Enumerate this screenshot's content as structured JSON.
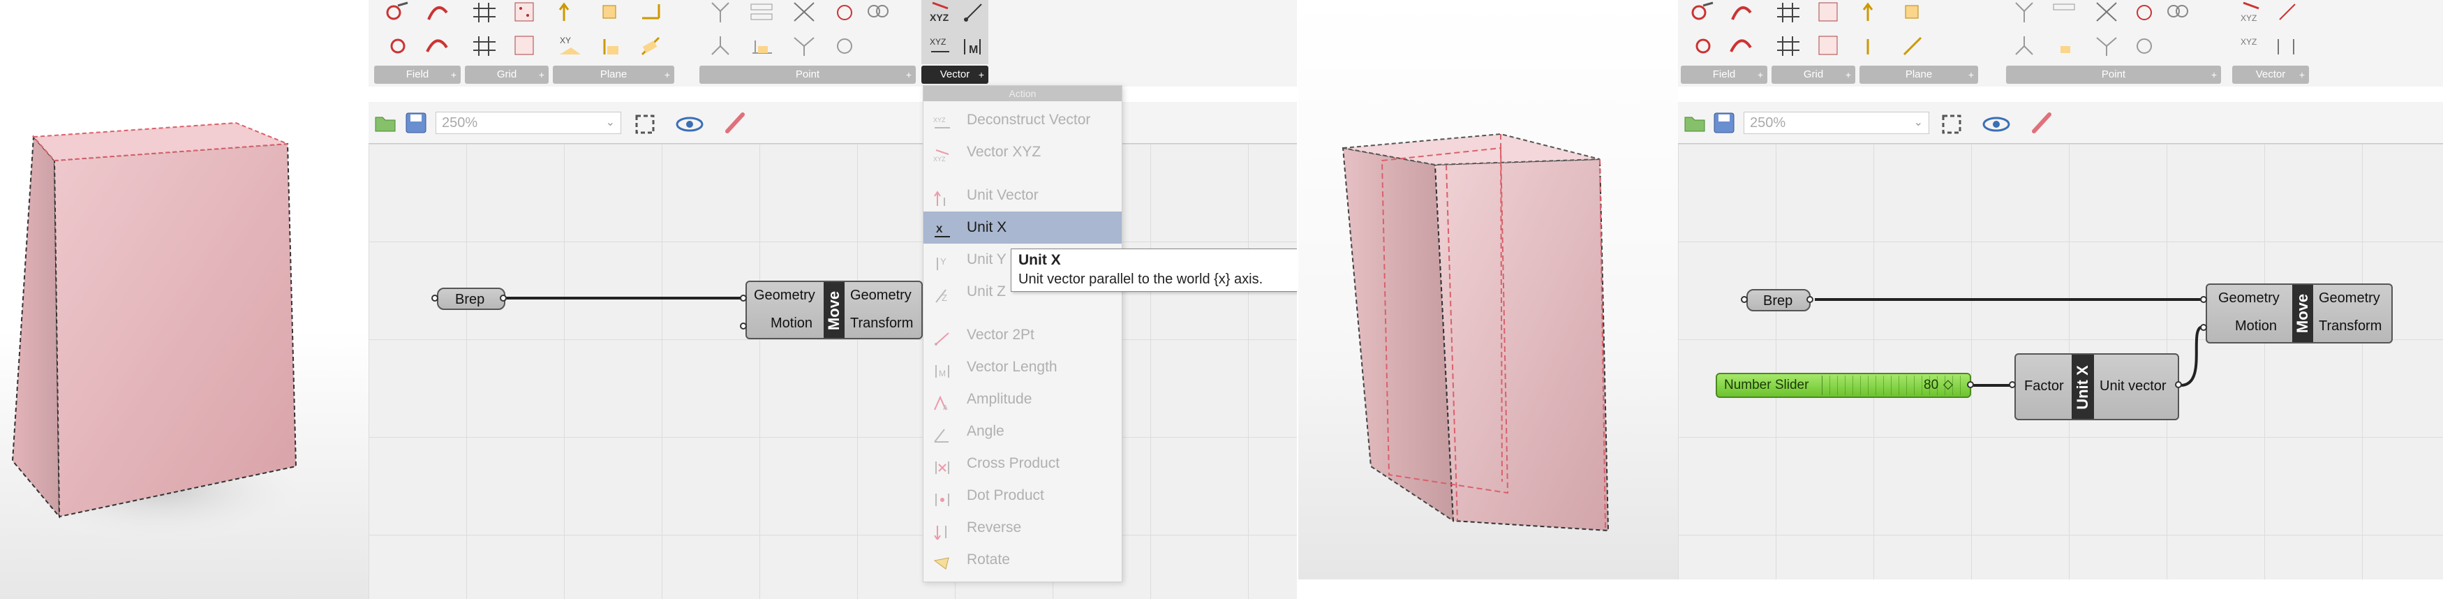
{
  "left_toolbar": {
    "groups": [
      "Field",
      "Grid",
      "Plane",
      "Point",
      "Vector"
    ],
    "zoom": "250%"
  },
  "right_toolbar": {
    "groups": [
      "Field",
      "Grid",
      "Plane",
      "Point",
      "Vector"
    ],
    "zoom": "250%"
  },
  "dropdown": {
    "header": "Action",
    "items": [
      {
        "label": "Deconstruct Vector"
      },
      {
        "label": "Vector XYZ"
      },
      {
        "label": "Unit Vector"
      },
      {
        "label": "Unit X"
      },
      {
        "label": "Unit Y"
      },
      {
        "label": "Unit Z"
      },
      {
        "label": "Vector 2Pt"
      },
      {
        "label": "Vector Length"
      },
      {
        "label": "Amplitude"
      },
      {
        "label": "Angle"
      },
      {
        "label": "Cross Product"
      },
      {
        "label": "Dot Product"
      },
      {
        "label": "Reverse"
      },
      {
        "label": "Rotate"
      }
    ]
  },
  "tooltip": {
    "title": "Unit X",
    "description": "Unit vector parallel to the world {x} axis."
  },
  "left_canvas": {
    "brep": "Brep",
    "move": {
      "title": "Move",
      "inputs": [
        "Geometry",
        "Motion"
      ],
      "outputs": [
        "Geometry",
        "Transform"
      ]
    }
  },
  "right_canvas": {
    "brep": "Brep",
    "move": {
      "title": "Move",
      "inputs": [
        "Geometry",
        "Motion"
      ],
      "outputs": [
        "Geometry",
        "Transform"
      ]
    },
    "slider": {
      "label": "Number Slider",
      "value": "80"
    },
    "unitx": {
      "title": "Unit X",
      "input": "Factor",
      "output": "Unit vector"
    }
  },
  "colors": {
    "box_face": "#e6b9be",
    "box_edge": "#d9606a",
    "slider_green": "#7ad13a",
    "menu_highlight": "#a9b7d0"
  }
}
